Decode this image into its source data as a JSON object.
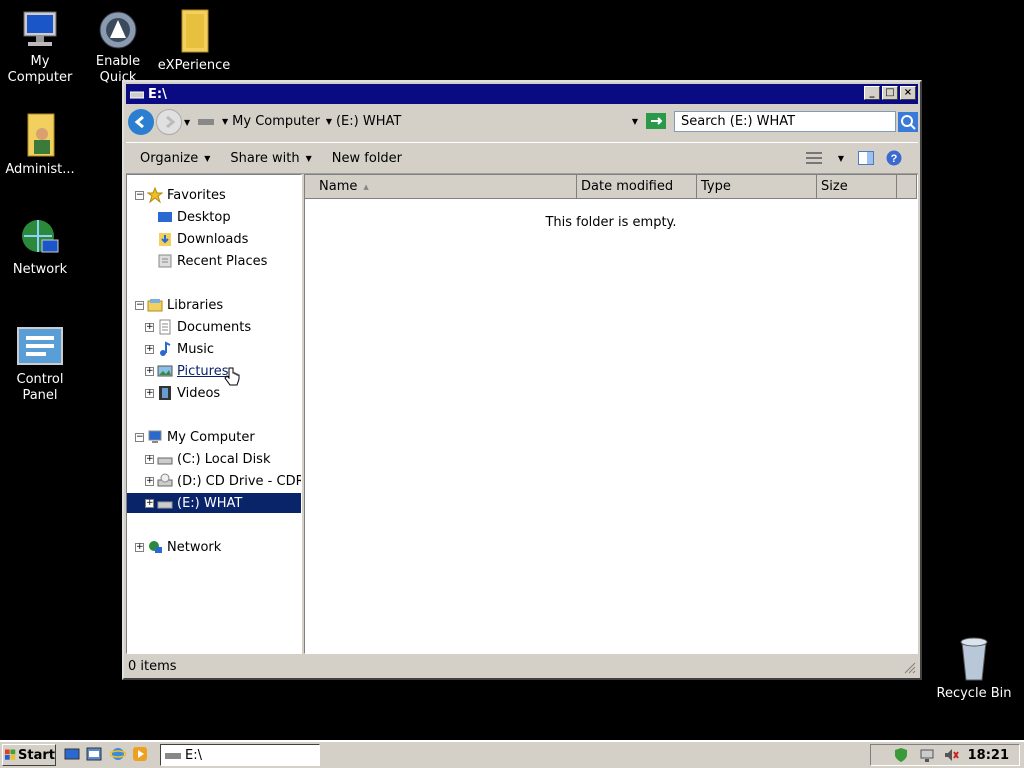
{
  "desktop": {
    "icons": [
      {
        "name": "my-computer",
        "label": "My Computer"
      },
      {
        "name": "enable-quicklook",
        "label": "Enable Quick"
      },
      {
        "name": "experience",
        "label": "eXPerience"
      },
      {
        "name": "administrator",
        "label": "Administ..."
      },
      {
        "name": "network",
        "label": "Network"
      },
      {
        "name": "control-panel",
        "label": "Control Panel"
      },
      {
        "name": "recycle-bin",
        "label": "Recycle Bin"
      }
    ]
  },
  "window": {
    "title": "E:\\",
    "breadcrumb": [
      "My Computer",
      "(E:) WHAT"
    ],
    "search_placeholder": "Search (E:) WHAT",
    "commands": {
      "organize": "Organize",
      "share_with": "Share with",
      "new_folder": "New folder"
    },
    "nav": {
      "favorites": {
        "label": "Favorites",
        "items": [
          "Desktop",
          "Downloads",
          "Recent Places"
        ]
      },
      "libraries": {
        "label": "Libraries",
        "items": [
          "Documents",
          "Music",
          "Pictures",
          "Videos"
        ]
      },
      "computer": {
        "label": "My Computer",
        "items": [
          "(C:) Local Disk",
          "(D:) CD Drive - CDR",
          "(E:) WHAT"
        ]
      },
      "network": {
        "label": "Network"
      }
    },
    "columns": [
      "Name",
      "Date modified",
      "Type",
      "Size"
    ],
    "empty_message": "This folder is empty.",
    "status": "0 items"
  },
  "taskbar": {
    "start_label": "Start",
    "task_label": "E:\\",
    "clock": "18:21"
  }
}
